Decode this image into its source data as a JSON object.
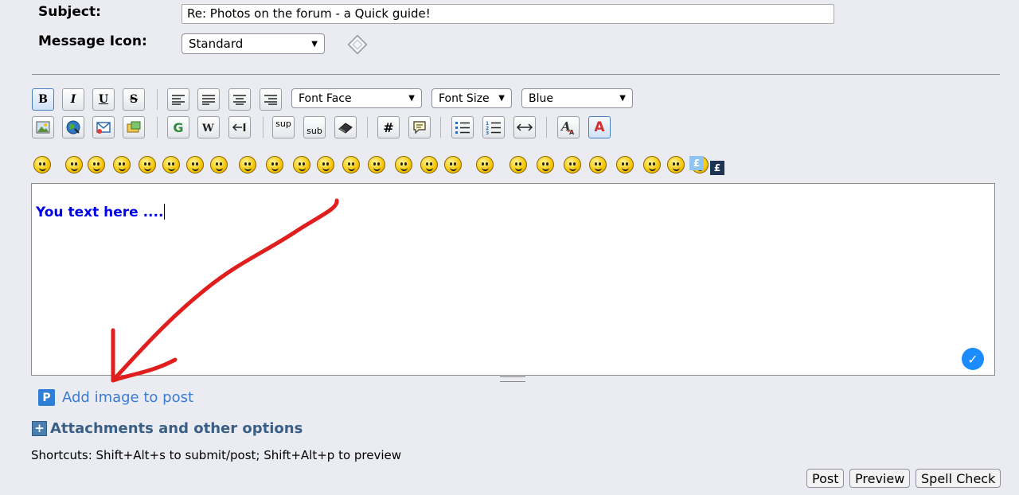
{
  "form": {
    "subject_label": "Subject:",
    "subject_value": "Re: Photos on the forum - a Quick guide!",
    "icon_label": "Message Icon:",
    "icon_value": "Standard"
  },
  "toolbar": {
    "row1": {
      "bold": "B",
      "italic": "I",
      "underline": "U",
      "strike": "S",
      "font_face": "Font Face",
      "font_size": "Font Size",
      "font_color": "Blue"
    },
    "row2": {
      "google": "G",
      "sup": "sup",
      "sub": "sub",
      "hash": "#",
      "text_color": "A"
    }
  },
  "smilies_count": 26,
  "editor": {
    "text": "You text here ...."
  },
  "links": {
    "add_image": "Add image to post",
    "attachments": "Attachments and other options"
  },
  "shortcuts": "Shortcuts: Shift+Alt+s to submit/post; Shift+Alt+p to preview",
  "buttons": {
    "post": "Post",
    "preview": "Preview",
    "spell_check": "Spell Check"
  },
  "colors": {
    "background": "#eaecf1",
    "editor_text": "#0000ee",
    "link": "#3a7bd5",
    "annotation_arrow": "#e01e1e"
  }
}
